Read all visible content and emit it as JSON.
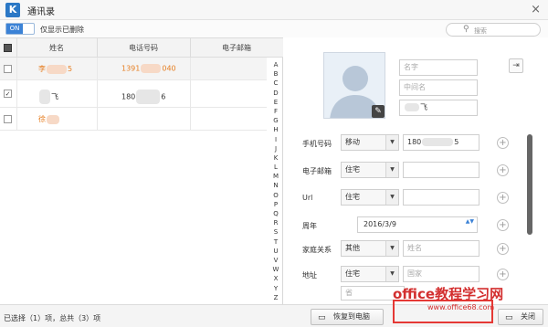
{
  "window": {
    "title": "通讯录",
    "app_icon_letter": "K",
    "close_glyph": "×"
  },
  "toolbar": {
    "toggle_on": "ON",
    "toggle_label": "仅显示已删除",
    "search_placeholder": "搜索"
  },
  "table": {
    "headers": [
      "姓名",
      "电话号码",
      "电子邮箱"
    ],
    "rows": [
      {
        "name_prefix": "李",
        "name_suffix": "5",
        "phone_prefix": "1391",
        "phone_suffix": "040",
        "checked": false,
        "highlight": true
      },
      {
        "name_prefix": "",
        "name_suffix": "飞",
        "phone_prefix": "180",
        "phone_suffix": "6",
        "checked": true,
        "highlight": false
      },
      {
        "name_prefix": "徐",
        "name_suffix": "",
        "phone_prefix": "",
        "phone_suffix": "",
        "checked": false,
        "highlight": true
      }
    ],
    "checkmark": "✓"
  },
  "alphabet": [
    "A",
    "B",
    "C",
    "D",
    "E",
    "F",
    "G",
    "H",
    "I",
    "J",
    "K",
    "L",
    "M",
    "N",
    "O",
    "P",
    "Q",
    "R",
    "S",
    "T",
    "U",
    "V",
    "W",
    "X",
    "Y",
    "Z"
  ],
  "detail": {
    "first_name_placeholder": "名字",
    "middle_name_placeholder": "中间名",
    "last_name_value": "飞",
    "pencil_glyph": "✎",
    "export_glyph": "⇥",
    "labels": {
      "phone": "手机号码",
      "email": "电子邮箱",
      "url": "Url",
      "anniversary": "周年",
      "family": "家庭关系",
      "address": "地址"
    },
    "phone_type": "移动",
    "phone_value_prefix": "180",
    "phone_value_suffix": "5",
    "email_type": "住宅",
    "url_type": "住宅",
    "anniversary_date": "2016/3/9",
    "family_type": "其他",
    "family_placeholder": "姓名",
    "address_type": "住宅",
    "address_placeholder_country": "国家",
    "address_placeholder_province": "省",
    "plus_glyph": "+",
    "dropdown_glyph": "▼",
    "spin_glyph": "▲▼"
  },
  "footer": {
    "status": "已选择（1）项，总共（3）项",
    "restore_button": "恢复到电脑",
    "close_button": "关闭",
    "restore_icon": "▭",
    "close_icon": "▭"
  },
  "watermark": {
    "line1": "office教程学习网",
    "line2": "www.office68.com"
  },
  "colors": {
    "accent": "#3b82d6",
    "highlight_name": "#e67e22",
    "watermark": "#d32f2f"
  }
}
